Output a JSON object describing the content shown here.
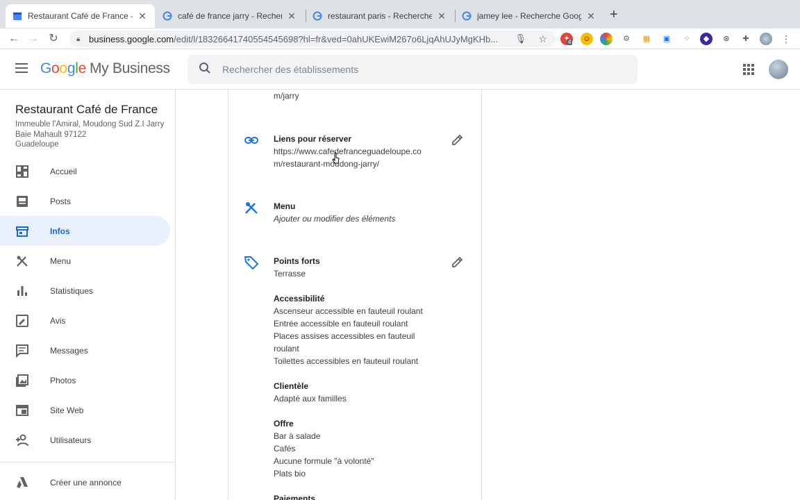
{
  "browser": {
    "tabs": [
      {
        "title": "Restaurant Café de France – Ir",
        "active": true
      },
      {
        "title": "café de france jarry - Recherch",
        "active": false
      },
      {
        "title": "restaurant paris - Recherche G",
        "active": false
      },
      {
        "title": "jamey lee - Recherche Google",
        "active": false
      }
    ],
    "url_host": "business.google.com",
    "url_rest": "/edit/l/18326641740554545698?hl=fr&ved=0ahUKEwiM267o6LjqAhUJyMgKHb...",
    "ext_badge": "4"
  },
  "header": {
    "logo_google": [
      "G",
      "o",
      "o",
      "g",
      "l",
      "e"
    ],
    "logo_product": "My Business",
    "search_placeholder": "Rechercher des établissements"
  },
  "sidebar": {
    "business_name": "Restaurant Café de France",
    "address_line1": "Immeuble l'Amiral, Moudong Sud Z.I Jarry",
    "address_line2": "Baie Mahault 97122",
    "address_line3": "Guadeloupe",
    "items": [
      {
        "label": "Accueil",
        "icon": "dashboard-icon"
      },
      {
        "label": "Posts",
        "icon": "posts-icon"
      },
      {
        "label": "Infos",
        "icon": "storefront-icon",
        "active": true
      },
      {
        "label": "Menu",
        "icon": "utensils-icon"
      },
      {
        "label": "Statistiques",
        "icon": "bar-chart-icon"
      },
      {
        "label": "Avis",
        "icon": "review-icon"
      },
      {
        "label": "Messages",
        "icon": "message-icon"
      },
      {
        "label": "Photos",
        "icon": "photos-icon"
      },
      {
        "label": "Site Web",
        "icon": "website-icon"
      },
      {
        "label": "Utilisateurs",
        "icon": "add-user-icon"
      }
    ],
    "ad_label": "Créer une annonce"
  },
  "main": {
    "top_fragment": "m/jarry",
    "booking": {
      "title": "Liens pour réserver",
      "line1": "https://www.cafedefranceguadeloupe.co",
      "line2": "m/restaurant-moudong-jarry/"
    },
    "menu": {
      "title": "Menu",
      "subtitle": "Ajouter ou modifier des éléments"
    },
    "highlights": {
      "title": "Points forts",
      "value": "Terrasse",
      "groups": [
        {
          "title": "Accessibilité",
          "items": [
            "Ascenseur accessible en fauteuil roulant",
            "Entrée accessible en fauteuil roulant",
            "Places assises accessibles en fauteuil roulant",
            "Toilettes accessibles en fauteuil roulant"
          ]
        },
        {
          "title": "Clientèle",
          "items": [
            "Adapté aux familles"
          ]
        },
        {
          "title": "Offre",
          "items": [
            "Bar à salade",
            "Cafés",
            "Aucune formule \"à volonté\"",
            "Plats bio"
          ]
        },
        {
          "title": "Paiements",
          "items": []
        }
      ]
    }
  },
  "colors": {
    "accent": "#1967d2",
    "active_bg": "#e8f0fe",
    "icon_blue": "#1a73e8"
  }
}
